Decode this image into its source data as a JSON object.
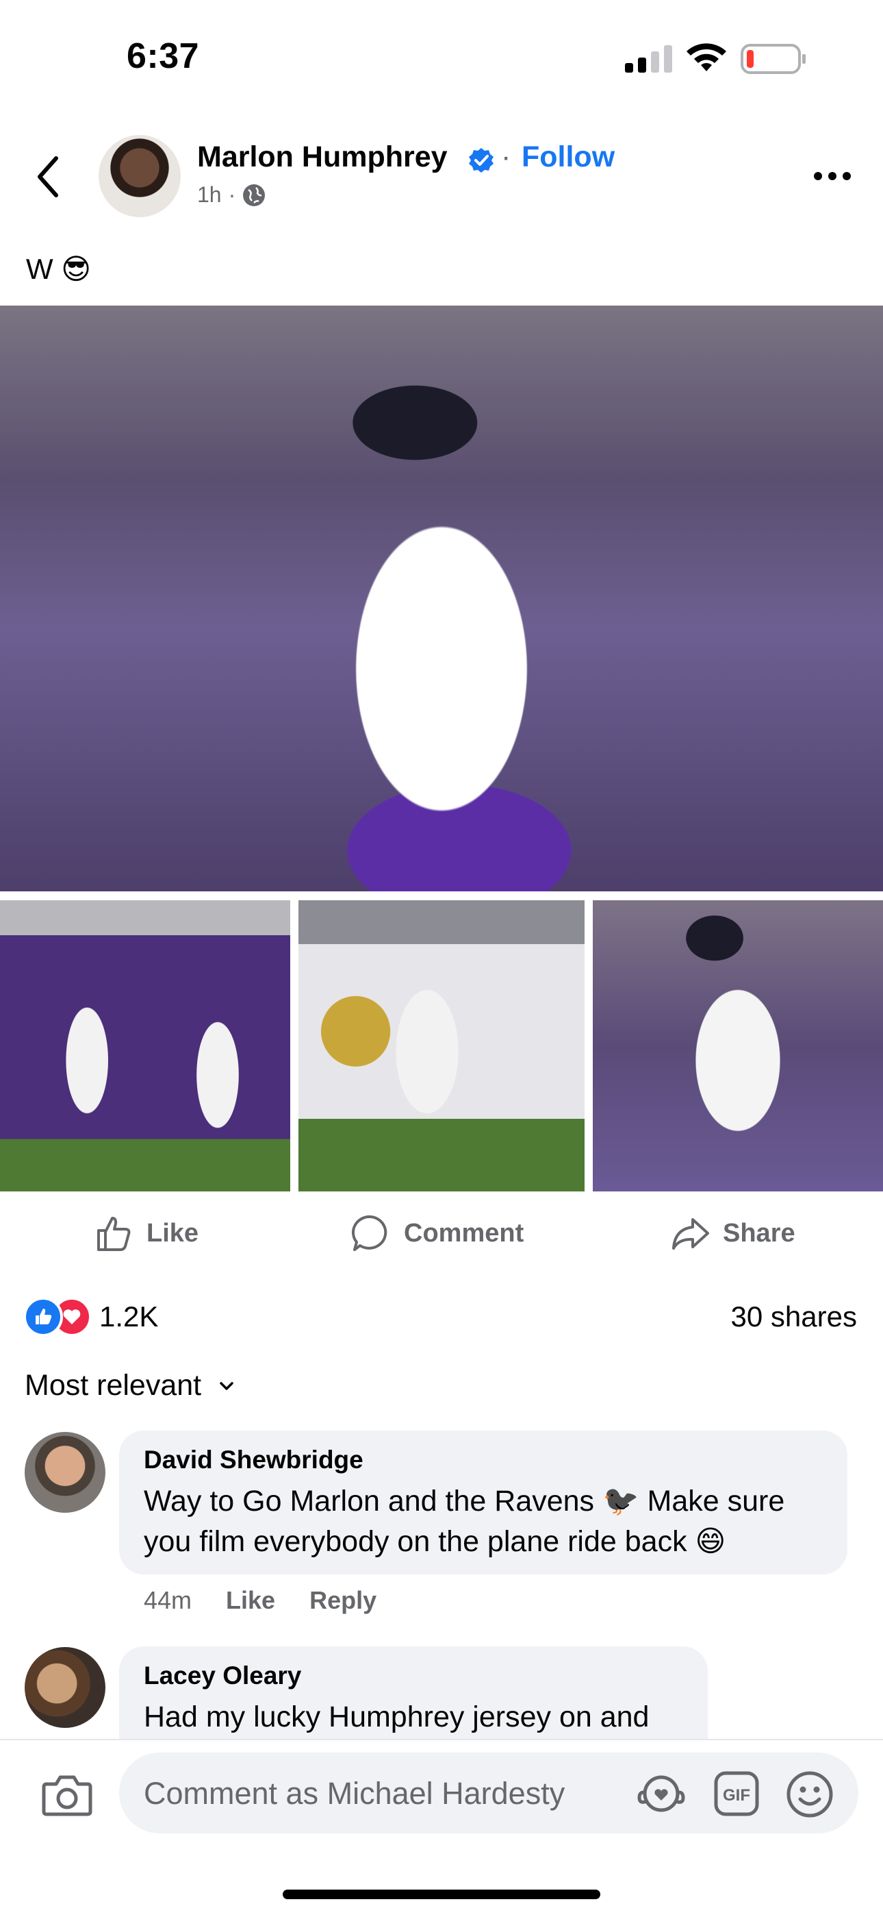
{
  "status_bar": {
    "time": "6:37"
  },
  "post": {
    "author": "Marlon Humphrey",
    "separator": "·",
    "follow_label": "Follow",
    "time": "1h",
    "meta_dot": "·",
    "caption": "W 😎"
  },
  "actions": {
    "like": "Like",
    "comment": "Comment",
    "share": "Share"
  },
  "stats": {
    "reaction_count": "1.2K",
    "shares": "30 shares"
  },
  "sort_label": "Most relevant",
  "comments": [
    {
      "name": "David Shewbridge",
      "text": "Way to Go Marlon and the Ravens 🐦‍⬛ Make sure you film everybody on the plane ride back 😄",
      "time": "44m",
      "like": "Like",
      "reply": "Reply"
    },
    {
      "name": "Lacey Oleary",
      "text": "Had my lucky Humphrey jersey on and"
    }
  ],
  "composer": {
    "placeholder": "Comment as Michael Hardesty"
  },
  "colors": {
    "accent": "#1877f2",
    "love": "#f02849",
    "bubble": "#f0f2f5",
    "secondary_text": "#65676b"
  }
}
